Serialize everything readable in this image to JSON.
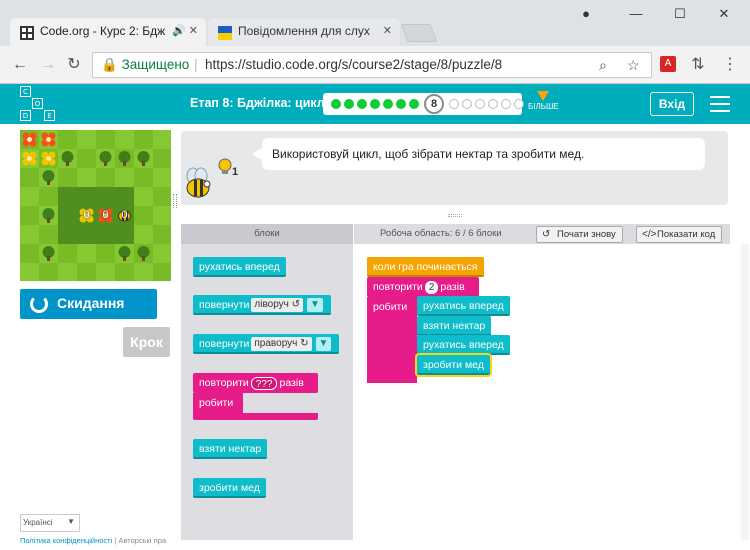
{
  "browser": {
    "tabs": [
      {
        "title": "Code.org - Курс 2: Бдж",
        "active": true
      },
      {
        "title": "Повідомлення для слух",
        "active": false
      }
    ],
    "secure_label": "Защищено",
    "url": "https://studio.code.org/s/course2/stage/8/puzzle/8"
  },
  "header": {
    "logo_letters": [
      "C",
      "O",
      "D",
      "E"
    ],
    "stage_title": "Етап 8: Бджілка: цикли",
    "progress": {
      "completed": 7,
      "current": "8",
      "remaining": 6
    },
    "more_label": "БІЛЬШЕ",
    "signin_label": "Вхід"
  },
  "left": {
    "reset_label": "Скидання",
    "step_label": "Крок",
    "language": "Українсі",
    "footer": {
      "privacy": "Політика конфіденційності",
      "copyright": "Авторські пра"
    }
  },
  "maze": {
    "grid": [
      [
        "flowerR",
        "flowerR",
        "grass",
        "grass",
        "grass",
        "grass",
        "grass",
        "grass"
      ],
      [
        "flowerY",
        "flowerY",
        "tree",
        "grass",
        "tree",
        "tree",
        "tree",
        "grass"
      ],
      [
        "grass",
        "tree",
        "grass",
        "grass",
        "grass",
        "grass",
        "grass",
        "grass"
      ],
      [
        "grass",
        "grass",
        "path",
        "path",
        "path",
        "path",
        "grass",
        "grass"
      ],
      [
        "grass",
        "tree",
        "path",
        "flowerY0",
        "flowerR0",
        "bee",
        "grass",
        "grass"
      ],
      [
        "grass",
        "grass",
        "path",
        "path",
        "path",
        "path",
        "grass",
        "grass"
      ],
      [
        "grass",
        "tree",
        "grass",
        "grass",
        "grass",
        "tree",
        "tree",
        "grass"
      ],
      [
        "grass",
        "grass",
        "grass",
        "grass",
        "grass",
        "grass",
        "grass",
        "grass"
      ]
    ],
    "counts": [
      "0",
      "0",
      "0"
    ]
  },
  "instructions": {
    "text": "Використовуй цикл, щоб зібрати нектар та зробити мед.",
    "hint_count": "1"
  },
  "workspace": {
    "toolbox_header": "блоки",
    "workspace_header": "Робоча область: 6 / 6 блоки",
    "restart_label": "Почати знову",
    "show_code_label": "Показати код"
  },
  "toolbox_blocks": {
    "move_forward": "рухатись вперед",
    "turn_left": "повернути",
    "turn_left_dd": "ліворуч ↺",
    "turn_right": "повернути",
    "turn_right_dd": "праворуч ↻",
    "repeat": "повторити",
    "repeat_count": "???",
    "repeat_times": "разів",
    "repeat_do": "робити",
    "get_nectar": "взяти нектар",
    "make_honey": "зробити мед"
  },
  "program": {
    "when_run": "коли гра починається",
    "repeat": "повторити",
    "repeat_count": "2",
    "repeat_times": "разів",
    "repeat_do": "робити",
    "body": [
      "рухатись вперед",
      "взяти нектар",
      "рухатись вперед",
      "зробити мед"
    ]
  },
  "colors": {
    "header": "#00adbc",
    "motion_block": "#0fbdca",
    "loop_block": "#e51c8a",
    "event_block": "#f5a400",
    "reset_button": "#0094ca",
    "progress_done": "#0ecc35"
  }
}
